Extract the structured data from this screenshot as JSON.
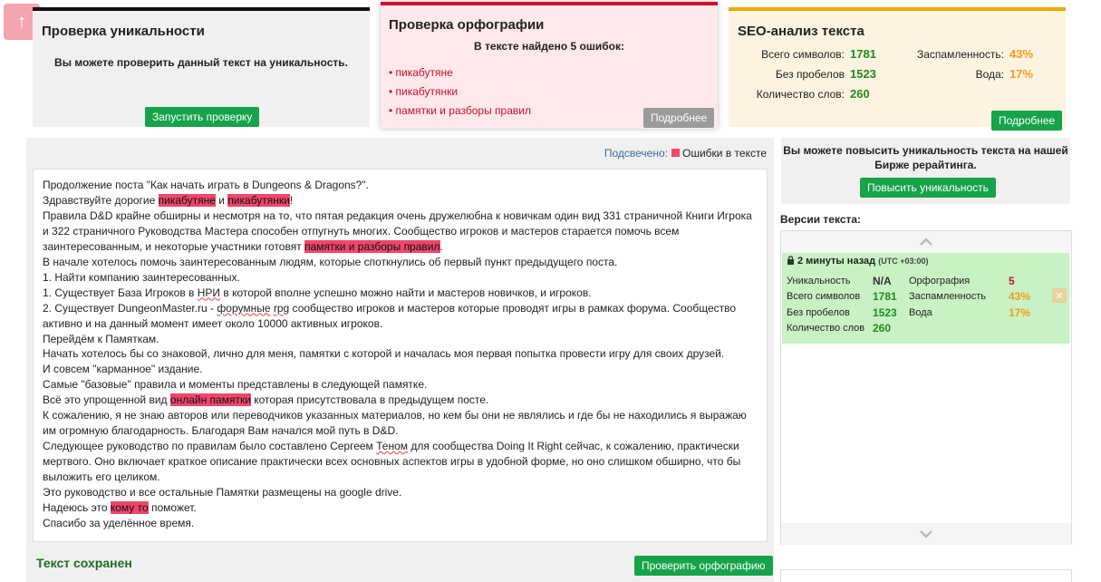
{
  "scroll_top": {
    "icon": "arrow-up-icon",
    "glyph": "↑"
  },
  "uniqueness": {
    "title": "Проверка уникальности",
    "message": "Вы можете проверить данный текст на уникальность.",
    "button": "Запустить проверку"
  },
  "spelling": {
    "title": "Проверка орфографии",
    "found": "В тексте найдено 5 ошибок:",
    "errors": [
      "пикабутяне",
      "пикабутянки",
      "памятки и разборы правил"
    ],
    "button": "Подробнее"
  },
  "seo": {
    "title": "SEO-анализ текста",
    "total_chars_label": "Всего символов:",
    "total_chars": "1781",
    "no_spaces_label": "Без пробелов",
    "no_spaces": "1523",
    "words_label": "Количество слов:",
    "words": "260",
    "spam_label": "Заспамленность:",
    "spam": "43%",
    "water_label": "Вода:",
    "water": "17%",
    "button": "Подробнее"
  },
  "main": {
    "highlight_label": "Подсвечено:",
    "highlight_legend": "Ошибки в тексте",
    "saved": "Текст сохранен",
    "check_button": "Проверить орфографию",
    "text": {
      "l1": "Продолжение поста \"Как начать играть в Dungeons & Dragons?\".",
      "l2a": "Здравствуйте дорогие ",
      "l2b": "пикабутяне",
      "l2c": " и ",
      "l2d": "пикабутянки",
      "l2e": "!",
      "l3a": "Правила D&D крайне обширны и несмотря на то, что пятая редакция очень дружелюбна к новичкам один вид 331 страничной Книги Игрока и 322 страничного Руководства Мастера способен отпугнуть многих. Сообщество игроков и мастеров старается помочь всем заинтересованным, и некоторые участники готовят ",
      "l3b": "памятки и разборы правил",
      "l3c": ".",
      "l4": "В начале хотелось помочь заинтересованным людям, которые споткнулись об первый пункт предыдущего поста.",
      "l5": "1. Найти компанию заинтересованных.",
      "l6a": "1. Существует База Игроков в ",
      "l6b": "НРИ",
      "l6c": " в которой вполне успешно можно найти и мастеров новичков, и игроков.",
      "l7a": "2. Существует DungeonMaster.ru - ",
      "l7b": "форумные",
      "l7c": " ",
      "l7d": "rpg",
      "l7e": " сообщество игроков и мастеров которые проводят игры в рамках форума. Сообщество активно и на данный момент имеет около 10000 активных игроков.",
      "l8": "Перейдём к Памяткам.",
      "l9": "Начать хотелось бы со знаковой, лично для меня, памятки с которой и началась моя первая попытка провести игру для своих друзей.",
      "l10": "И совсем \"карманное\" издание.",
      "l11": "Самые \"базовые\" правила и моменты представлены в следующей памятке.",
      "l12a": "Всё это упрощенной вид ",
      "l12b": "онлайн памятки",
      "l12c": " которая присутствовала в предыдущем посте.",
      "l13": "К сожалению, я не знаю авторов или переводчиков указанных материалов, но кем бы они не являлись и где бы не находились я выражаю им огромную благодарность. Благодаря Вам начался мой путь в D&D.",
      "l14a": "Следующее руководство по правилам было составлено Сергеем ",
      "l14b": "Теном",
      "l14c": " для сообщества Doing It Right сейчас, к сожалению, практически мертвого. Оно включает краткое описание практически всех основных аспектов игры в удобной форме, но оно слишком обширно, что бы выложить его целиком.",
      "l15": "Это руководство и все остальные Памятки размещены на google drive.",
      "l16a": "Надеюсь это ",
      "l16b": "кому то",
      "l16c": " поможет.",
      "l17": "Спасибо за уделённое время."
    }
  },
  "boost": {
    "message": "Вы можете повысить уникальность текста на нашей Бирже рерайтинга.",
    "button": "Повысить уникальность"
  },
  "versions": {
    "title": "Версии текста:",
    "item": {
      "time": "2 минуты назад",
      "tz": "(UTC +03:00)",
      "uniq_label": "Уникальность",
      "uniq": "N/A",
      "chars_label": "Всего символов",
      "chars": "1781",
      "nospace_label": "Без пробелов",
      "nospace": "1523",
      "words_label": "Количество слов",
      "words": "260",
      "spell_label": "Орфография",
      "spell": "5",
      "spam_label": "Заспамленность",
      "spam": "43%",
      "water_label": "Вода",
      "water": "17%"
    }
  },
  "colors": {
    "accent_green": "#16a34a",
    "error_red": "#d0102b",
    "seo_orange": "#f0a800",
    "highlight": "#f0476b"
  }
}
